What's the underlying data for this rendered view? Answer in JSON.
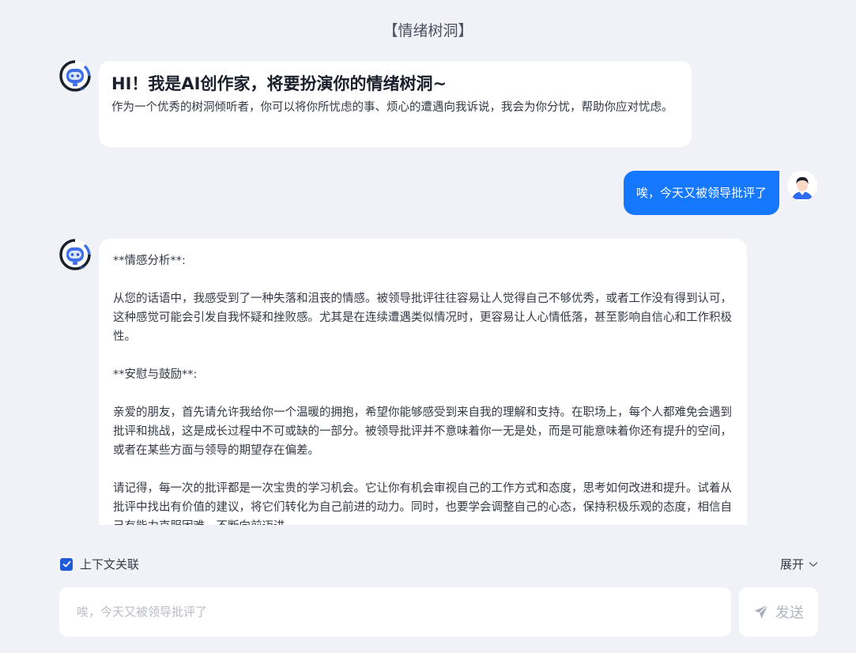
{
  "header": {
    "title": "【情绪树洞】"
  },
  "greeting": {
    "title": "HI！我是AI创作家，将要扮演你的情绪树洞~",
    "body": "作为一个优秀的树洞倾听者，你可以将你所忧虑的事、烦心的遭遇向我诉说，我会为你分忧，帮助你应对忧虑。"
  },
  "user_message": {
    "text": "唉，今天又被领导批评了"
  },
  "reply": {
    "paragraphs": [
      "**情感分析**:",
      "从您的话语中，我感受到了一种失落和沮丧的情感。被领导批评往往容易让人觉得自己不够优秀，或者工作没有得到认可，这种感觉可能会引发自我怀疑和挫败感。尤其是在连续遭遇类似情况时，更容易让人心情低落，甚至影响自信心和工作积极性。",
      "**安慰与鼓励**:",
      "亲爱的朋友，首先请允许我给你一个温暖的拥抱，希望你能够感受到来自我的理解和支持。在职场上，每个人都难免会遇到批评和挑战，这是成长过程中不可或缺的一部分。被领导批评并不意味着你一无是处，而是可能意味着你还有提升的空间，或者在某些方面与领导的期望存在偏差。",
      "请记得，每一次的批评都是一次宝贵的学习机会。它让你有机会审视自己的工作方式和态度，思考如何改进和提升。试着从批评中找出有价值的建议，将它们转化为自己前进的动力。同时，也要学会调整自己的心态，保持积极乐观的态度，相信自己有能力克服困难，不断向前迈进。"
    ]
  },
  "controls": {
    "context_label": "上下文关联",
    "context_checked": true,
    "expand_label": "展开"
  },
  "input": {
    "placeholder": "唉，今天又被领导批评了",
    "value": ""
  },
  "send": {
    "label": "发送"
  },
  "icons": {
    "bot": "robot-avatar-icon",
    "user": "user-avatar-icon",
    "send": "paper-plane-icon",
    "expand": "chevron-down-icon",
    "checkbox": "checkmark-icon"
  },
  "colors": {
    "accent": "#1677ff",
    "background": "#f0f2f7",
    "bubble": "#ffffff",
    "checkbox": "#1f5bd8"
  }
}
